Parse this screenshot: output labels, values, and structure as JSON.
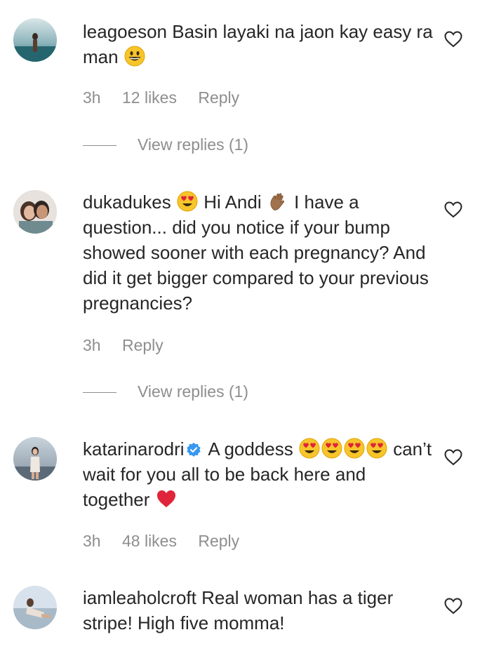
{
  "comments": [
    {
      "username": "leagoeson",
      "text": "Basin layaki na jaon kay easy ra man",
      "time": "3h",
      "likes": "12 likes",
      "reply_label": "Reply",
      "view_replies": "View replies (1)"
    },
    {
      "username": "dukadukes",
      "text_part1": "Hi Andi",
      "text_part2": "I have a question... did you notice if your bump showed sooner with each pregnancy? And did it get bigger compared to your previous pregnancies?",
      "time": "3h",
      "reply_label": "Reply",
      "view_replies": "View replies (1)"
    },
    {
      "username": "katarinarodri",
      "text_part1": "A goddess",
      "text_part2": "can’t wait for you all to be back here and together",
      "time": "3h",
      "likes": "48 likes",
      "reply_label": "Reply"
    },
    {
      "username": "iamleaholcroft",
      "text": "Real woman has a tiger stripe! High five momma!"
    }
  ],
  "colors": {
    "text": "#262626",
    "secondary": "#8e8e8e",
    "verified": "#3897f0",
    "heart_emoji": "#e0243a"
  },
  "icons": {
    "like": "heart-outline-icon",
    "verified": "verified-badge-icon",
    "emoji_smile": "grinning-face-emoji",
    "emoji_heart_eyes": "heart-eyes-emoji",
    "emoji_wave": "waving-hand-emoji",
    "emoji_red_heart": "red-heart-emoji"
  }
}
